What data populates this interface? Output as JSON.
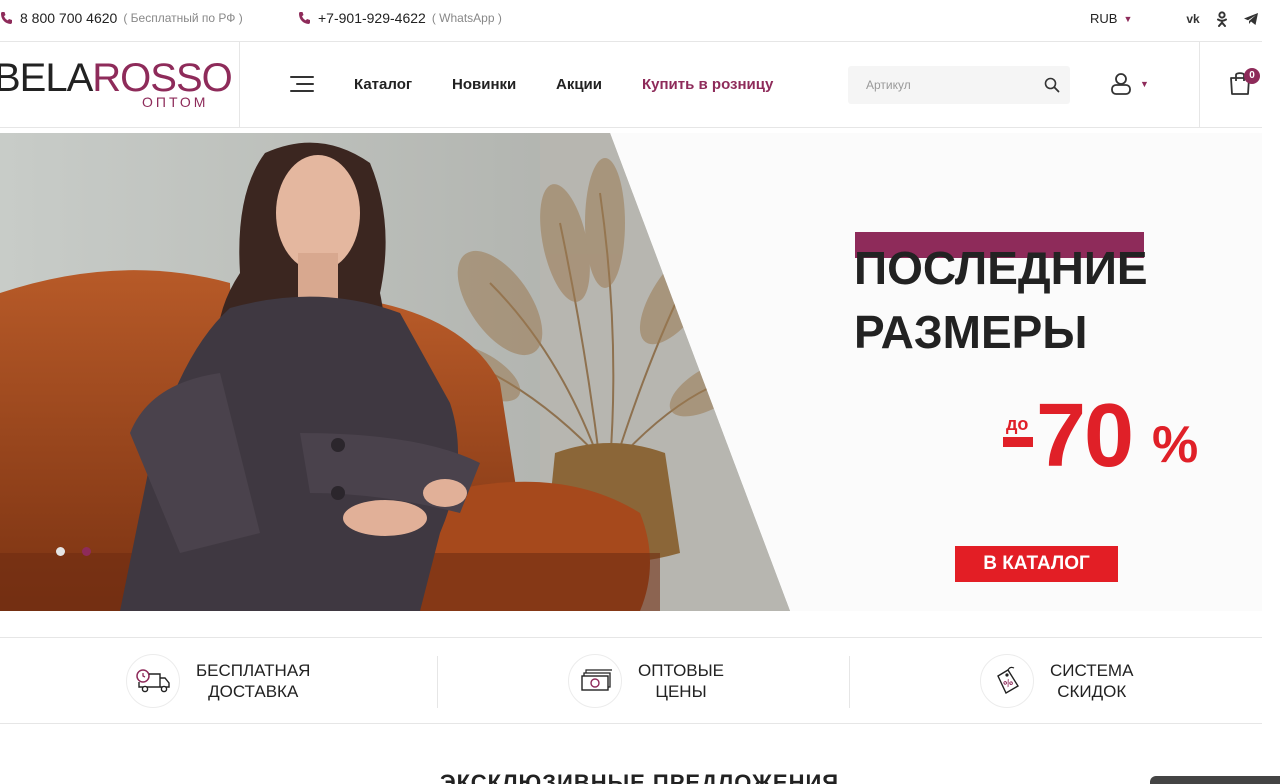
{
  "topbar": {
    "phone1": "8 800 700 4620",
    "phone1_note": "( Бесплатный по РФ )",
    "phone2": "+7-901-929-4622",
    "phone2_note": "( WhatsApp )",
    "currency": "RUB",
    "socials": [
      "vk-icon",
      "odnoklassniki-icon",
      "telegram-icon"
    ]
  },
  "header": {
    "logo_left": "BELA",
    "logo_right": "ROSSO",
    "logo_sub": "ОПТОМ",
    "nav": {
      "catalog": "Каталог",
      "new": "Новинки",
      "sales": "Акции",
      "retail": "Купить в розницу"
    },
    "search_placeholder": "Артикул",
    "cart_count": "0"
  },
  "hero": {
    "title_line1": "ПОСЛЕДНИЕ",
    "title_line2": "РАЗМЕРЫ",
    "sale_prefix": "до",
    "sale_value": "70",
    "sale_percent": "%",
    "cta": "В КАТАЛОГ",
    "slides_total": 2,
    "active_slide": 2
  },
  "features": [
    {
      "line1": "БЕСПЛАТНАЯ",
      "line2": "ДОСТАВКА",
      "icon": "delivery-truck-icon"
    },
    {
      "line1": "ОПТОВЫЕ",
      "line2": "ЦЕНЫ",
      "icon": "money-stack-icon"
    },
    {
      "line1": "СИСТЕМА",
      "line2": "СКИДОК",
      "icon": "discount-tag-icon"
    }
  ],
  "section_heading": "ЭКСКЛЮЗИВНЫЕ ПРЕДЛОЖЕНИЯ",
  "colors": {
    "brand": "#8e2b5a",
    "sale_red": "#e02028"
  }
}
